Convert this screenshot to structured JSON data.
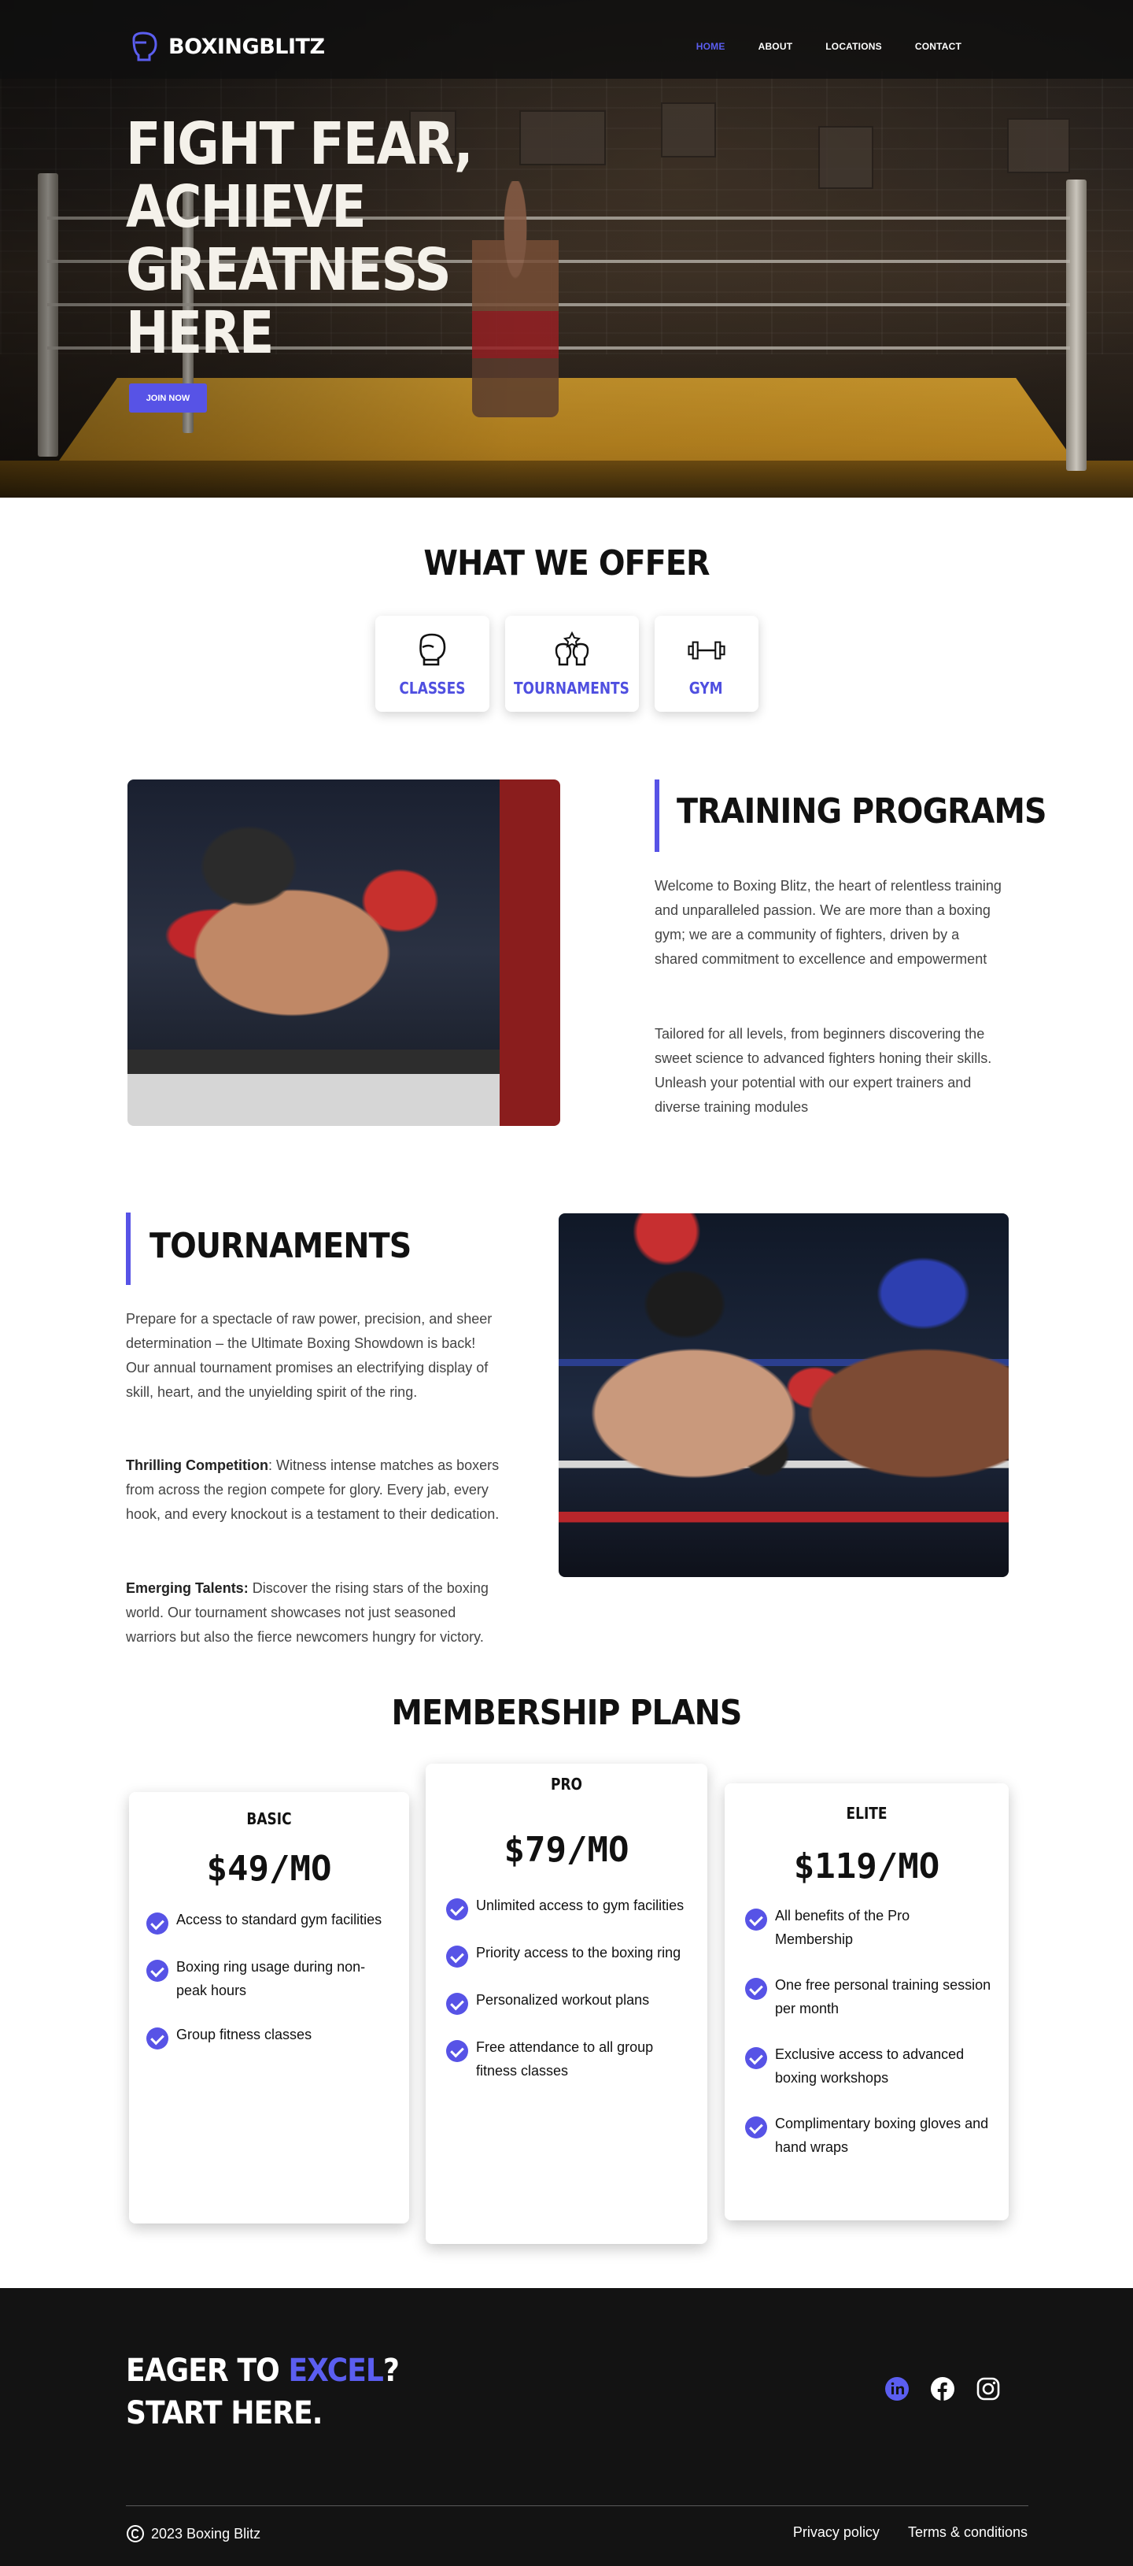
{
  "brand": {
    "name": "BOXINGBLITZ",
    "accent": "#5753e6"
  },
  "nav": {
    "items": [
      {
        "label": "HOME",
        "active": true
      },
      {
        "label": "ABOUT"
      },
      {
        "label": "LOCATIONS"
      },
      {
        "label": "CONTACT"
      }
    ]
  },
  "hero": {
    "title_lines": [
      "FIGHT FEAR,",
      "ACHIEVE",
      "GREATNESS",
      "HERE"
    ],
    "cta_label": "JOIN NOW"
  },
  "offer": {
    "title": "WHAT WE OFFER",
    "items": [
      {
        "label": "CLASSES",
        "icon": "boxing-glove-icon"
      },
      {
        "label": "TOURNAMENTS",
        "icon": "trophy-gloves-icon"
      },
      {
        "label": "GYM",
        "icon": "dumbbell-icon"
      }
    ]
  },
  "training": {
    "title": "TRAINING PROGRAMS",
    "paragraphs": [
      "Welcome to Boxing Blitz, the heart of relentless training and unparalleled passion. We are more than a boxing gym; we are a community of fighters, driven by a shared commitment to excellence and empowerment",
      "Tailored for all levels, from beginners discovering the sweet science to advanced fighters honing their skills. Unleash your potential with our expert trainers and diverse training modules"
    ]
  },
  "tournaments": {
    "title": "TOURNAMENTS",
    "intro": "Prepare for a spectacle of raw power, precision, and sheer determination – the Ultimate Boxing Showdown is back! Our annual tournament promises an electrifying display of skill, heart, and the unyielding spirit of the ring.",
    "items": [
      {
        "lead": "Thrilling Competition",
        "text": ": Witness intense matches as boxers from across the region compete for glory. Every jab, every hook, and every knockout is a testament to their dedication."
      },
      {
        "lead": "Emerging Talents:",
        "text": " Discover the rising stars of the boxing world. Our tournament showcases not just seasoned warriors but also the fierce newcomers hungry for victory."
      }
    ]
  },
  "membership": {
    "title": "MEMBERSHIP PLANS",
    "plans": [
      {
        "name": "BASIC",
        "price": "$49/MO",
        "features": [
          "Access to standard gym facilities",
          "Boxing ring usage during non-peak hours",
          "Group fitness classes"
        ]
      },
      {
        "name": "PRO",
        "price": "$79/MO",
        "features": [
          "Unlimited access to gym facilities",
          "Priority access to the boxing ring",
          "Personalized workout plans",
          "Free attendance to all group fitness classes"
        ]
      },
      {
        "name": "ELITE",
        "price": "$119/MO",
        "features": [
          "All benefits of the Pro Membership",
          "One free personal training session per month",
          "Exclusive access to advanced boxing workshops",
          "Complimentary boxing gloves and hand wraps"
        ]
      }
    ]
  },
  "footer": {
    "cta_pre": "EAGER TO ",
    "cta_accent": "EXCEL",
    "cta_post": "?",
    "cta_line2": "START HERE.",
    "socials": [
      "linkedin-icon",
      "facebook-icon",
      "instagram-icon"
    ],
    "copyright": "2023 Boxing Blitz",
    "links": [
      "Privacy policy",
      "Terms & conditions"
    ]
  }
}
